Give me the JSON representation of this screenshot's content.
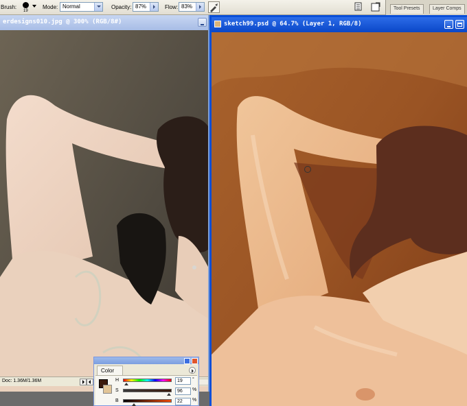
{
  "options_bar": {
    "brush_label": "Brush:",
    "brush_size": "19",
    "mode_label": "Mode:",
    "mode_value": "Normal",
    "opacity_label": "Opacity:",
    "opacity_value": "87%",
    "flow_label": "Flow:",
    "flow_value": "83%",
    "airbrush_icon": "airbrush-icon",
    "palette_well_tabs": [
      "Tool Presets",
      "Layer Comps"
    ]
  },
  "left_document": {
    "title": "erdesigns010.jpg @ 300% (RGB/8#)",
    "status": "Doc: 1.36M/1.36M"
  },
  "right_document": {
    "title": "sketch99.psd @ 64.7% (Layer 1, RGB/8)"
  },
  "color_palette": {
    "tab_label": "Color",
    "sliders": [
      {
        "label": "H",
        "value": "19",
        "unit": "°",
        "level": 0.053
      },
      {
        "label": "S",
        "value": "96",
        "unit": "%",
        "level": 0.96
      },
      {
        "label": "B",
        "value": "22",
        "unit": "%",
        "level": 0.22
      }
    ],
    "foreground_color": "#3b1a0c",
    "background_color": "#e2c597"
  }
}
